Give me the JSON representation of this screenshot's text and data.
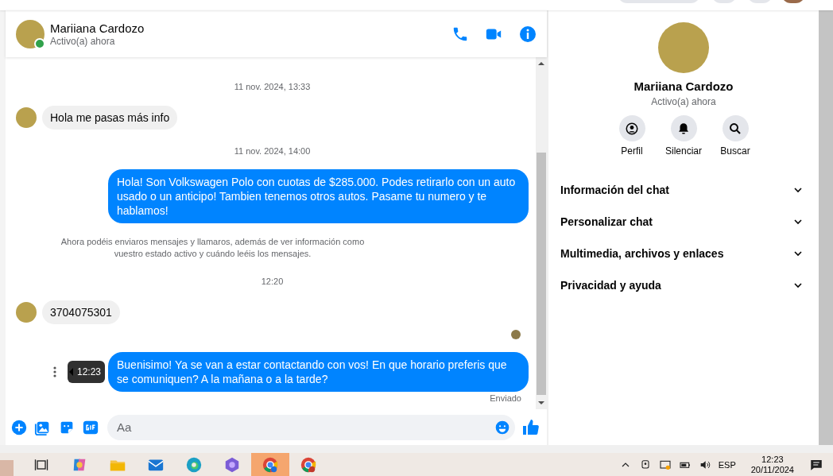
{
  "chat_header": {
    "name": "Mariiana Cardozo",
    "status": "Activo(a) ahora",
    "online": true
  },
  "messages": [
    {
      "kind": "time",
      "text": "11 nov. 2024, 13:33"
    },
    {
      "kind": "incoming",
      "text": "Hola me pasas más info"
    },
    {
      "kind": "time",
      "text": "11 nov. 2024, 14:00"
    },
    {
      "kind": "outgoing",
      "text": "Hola! Son Volkswagen Polo con cuotas de $285.000. Podes retirarlo con un auto usado o un anticipo! Tambien tenemos otros autos. Pasame tu numero y te hablamos!"
    },
    {
      "kind": "notice",
      "text": "Ahora podéis enviaros mensajes y llamaros, además de ver información como vuestro estado activo y cuándo leéis los mensajes."
    },
    {
      "kind": "time",
      "text": "12:20"
    },
    {
      "kind": "incoming",
      "text": "3704075301"
    },
    {
      "kind": "seen"
    },
    {
      "kind": "outgoing",
      "text": "Buenisimo! Ya se van a estar contactando con vos! En que horario preferis que se comuniquen? A la mañana o a la tarde?",
      "tooltip": "12:23"
    },
    {
      "kind": "status",
      "text": "Enviado"
    }
  ],
  "composer": {
    "placeholder": "Aa"
  },
  "info_panel": {
    "name": "Mariiana Cardozo",
    "status": "Activo(a) ahora",
    "actions": [
      {
        "kind": "profile",
        "label": "Perfil"
      },
      {
        "kind": "mute",
        "label": "Silenciar"
      },
      {
        "kind": "search",
        "label": "Buscar"
      }
    ],
    "sections": [
      {
        "label": "Información del chat",
        "expanded": false
      },
      {
        "label": "Personalizar chat",
        "expanded": false
      },
      {
        "label": "Multimedia, archivos y enlaces",
        "expanded": false
      },
      {
        "label": "Privacidad y ayuda",
        "expanded": false
      }
    ]
  },
  "taskbar": {
    "language": "ESP",
    "time": "12:23",
    "date": "20/11/2024"
  }
}
